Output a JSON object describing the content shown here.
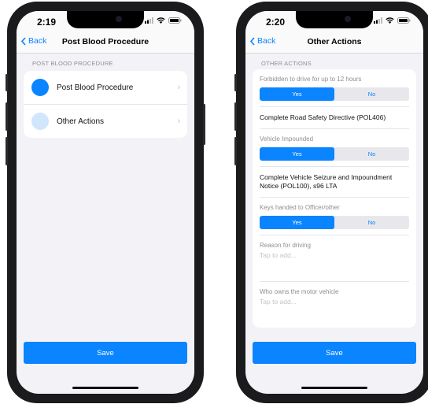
{
  "left": {
    "status": {
      "time": "2:19"
    },
    "nav": {
      "back_label": "Back",
      "title": "Post Blood Procedure"
    },
    "section_header": "POST BLOOD PROCEDURE",
    "items": [
      {
        "label": "Post Blood Procedure",
        "dot_color": "#0a84ff"
      },
      {
        "label": "Other Actions",
        "dot_color": "#cfe6fb"
      }
    ],
    "save_label": "Save"
  },
  "right": {
    "status": {
      "time": "2:20"
    },
    "nav": {
      "back_label": "Back",
      "title": "Other Actions"
    },
    "section_header": "OTHER ACTIONS",
    "q1": {
      "label": "Forbidden to drive for up to 12 hours",
      "yes": "Yes",
      "no": "No",
      "selected": "Yes"
    },
    "directive1": "Complete Road Safety Directive (POL406)",
    "q2": {
      "label": "Vehicle Impounded",
      "yes": "Yes",
      "no": "No",
      "selected": "Yes"
    },
    "directive2": "Complete Vehicle Seizure and Impoundment Notice (POL100), s96 LTA",
    "q3": {
      "label": "Keys handed to Officer/other",
      "yes": "Yes",
      "no": "No",
      "selected": "Yes"
    },
    "field1": {
      "label": "Reason for driving",
      "placeholder": "Tap to add..."
    },
    "field2": {
      "label": "Who owns the motor vehicle",
      "placeholder": "Tap to add..."
    },
    "save_label": "Save"
  },
  "colors": {
    "accent": "#0a84ff",
    "background": "#f2f2f7",
    "light_dot": "#cfe6fb"
  }
}
